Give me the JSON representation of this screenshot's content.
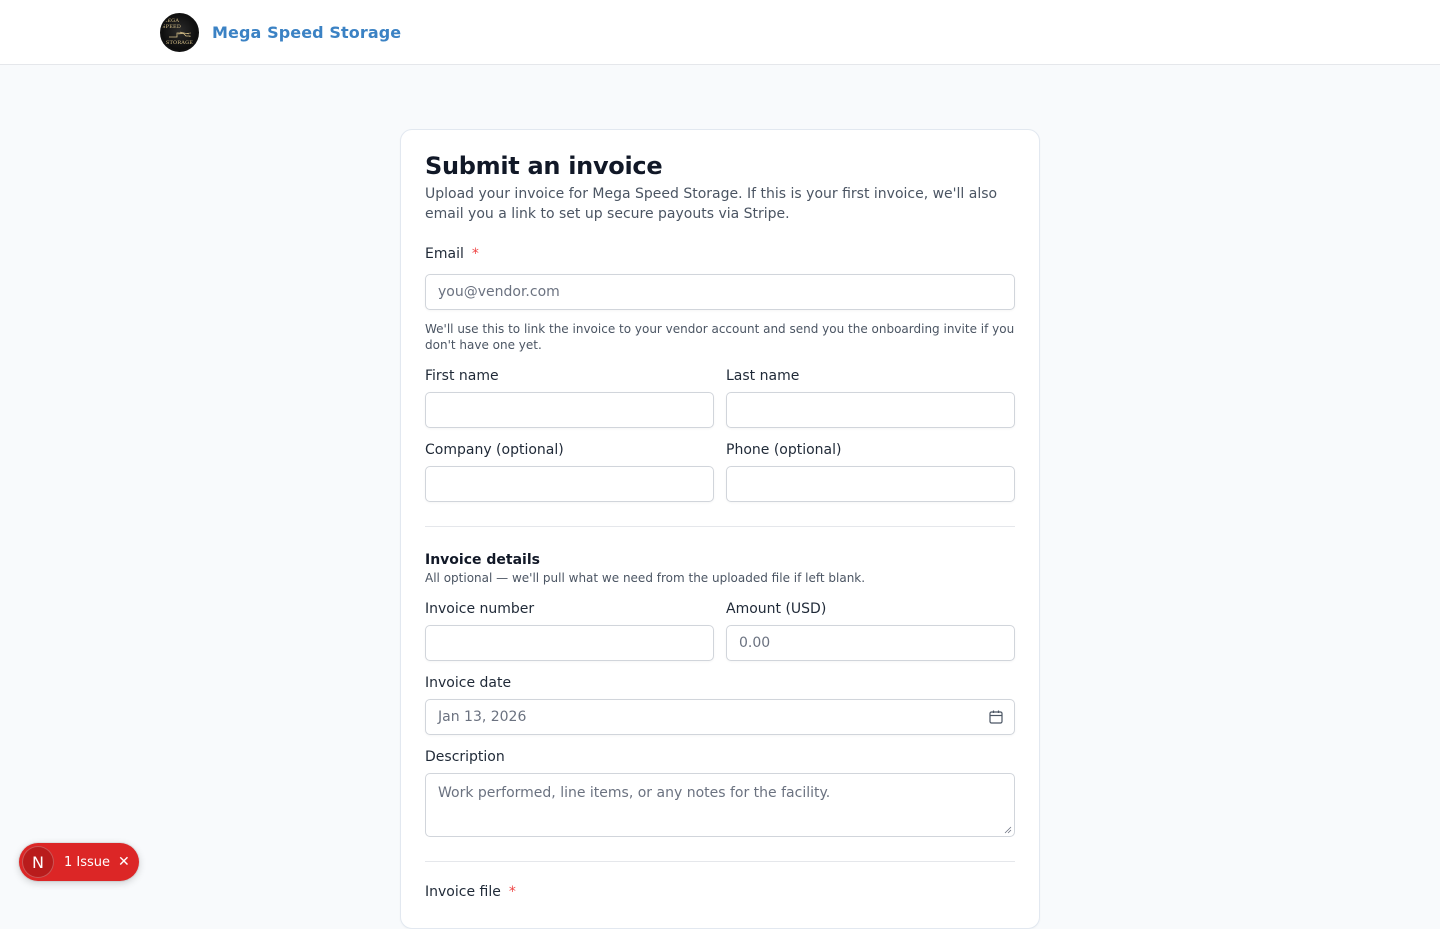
{
  "header": {
    "brand_name": "Mega Speed Storage",
    "logo": {
      "top_text": "MEGA SPEED",
      "bottom_text": "STORAGE"
    }
  },
  "form": {
    "title": "Submit an invoice",
    "intro": "Upload your invoice for Mega Speed Storage. If this is your first invoice, we'll also email you a link to set up secure payouts via Stripe.",
    "email": {
      "label": "Email",
      "required_mark": "*",
      "placeholder": "you@vendor.com",
      "value": "",
      "help": "We'll use this to link the invoice to your vendor account and send you the onboarding invite if you don't have one yet."
    },
    "first_name": {
      "label": "First name",
      "value": ""
    },
    "last_name": {
      "label": "Last name",
      "value": ""
    },
    "company": {
      "label": "Company (optional)",
      "value": ""
    },
    "phone": {
      "label": "Phone (optional)",
      "value": ""
    },
    "invoice_details": {
      "title": "Invoice details",
      "subtitle": "All optional — we'll pull what we need from the uploaded file if left blank.",
      "invoice_number": {
        "label": "Invoice number",
        "value": ""
      },
      "amount": {
        "label": "Amount (USD)",
        "placeholder": "0.00",
        "value": ""
      },
      "invoice_date": {
        "label": "Invoice date",
        "value": "Jan 13, 2026"
      },
      "description": {
        "label": "Description",
        "placeholder": "Work performed, line items, or any notes for the facility.",
        "value": ""
      }
    },
    "invoice_file": {
      "label": "Invoice file",
      "required_mark": "*"
    }
  },
  "dev_overlay": {
    "badge_letter": "N",
    "issues_label": "1 Issue",
    "close_icon": "close-icon"
  },
  "colors": {
    "brand": "#3b82c4",
    "required": "#ef4444",
    "issue_pill": "#dc2626"
  }
}
